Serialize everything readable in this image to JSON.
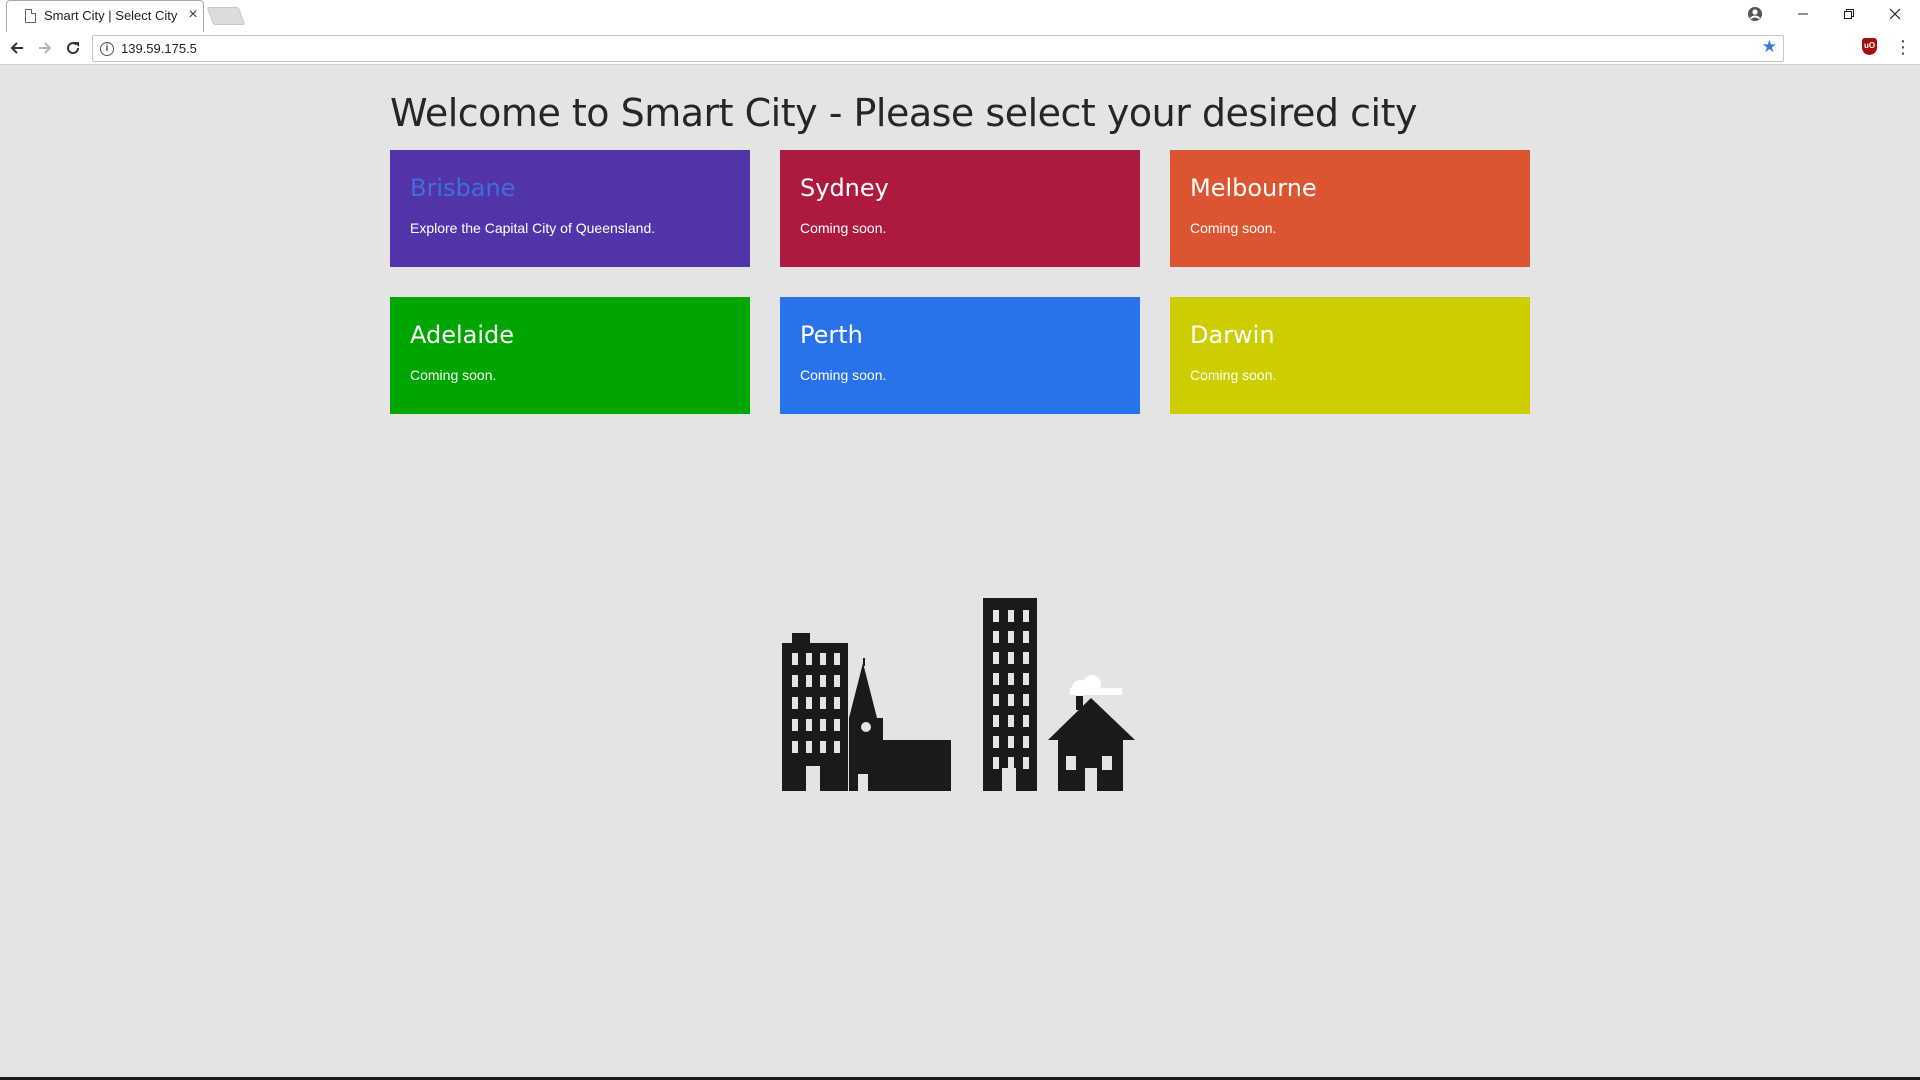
{
  "browser": {
    "tab_title": "Smart City | Select City",
    "tab_close_glyph": "×",
    "url": "139.59.175.5",
    "icons": [
      "page-icon",
      "close-icon",
      "profile-icon",
      "minimize-icon",
      "maximize-icon",
      "close-window-icon",
      "back-arrow-icon",
      "forward-arrow-icon",
      "reload-icon",
      "info-icon",
      "star-icon",
      "ublock-icon",
      "menu-icon"
    ]
  },
  "page": {
    "title": "Welcome to Smart City - Please select your desired city"
  },
  "cities": [
    {
      "name": "Brisbane",
      "description": "Explore the Capital City of Queensland.",
      "color": "#5233a8",
      "name_color": "#3d6fe0"
    },
    {
      "name": "Sydney",
      "description": "Coming soon.",
      "color": "#ae1a3e",
      "name_color": "#ffffff"
    },
    {
      "name": "Melbourne",
      "description": "Coming soon.",
      "color": "#dd5530",
      "name_color": "#ffffff"
    },
    {
      "name": "Adelaide",
      "description": "Coming soon.",
      "color": "#00a600",
      "name_color": "#ffffff"
    },
    {
      "name": "Perth",
      "description": "Coming soon.",
      "color": "#2872ec",
      "name_color": "#ffffff"
    },
    {
      "name": "Darwin",
      "description": "Coming soon.",
      "color": "#cdcd00",
      "name_color": "#ffffff"
    }
  ],
  "illustration": {
    "icon": "city-skyline-icon",
    "color": "#1a1a1a"
  }
}
